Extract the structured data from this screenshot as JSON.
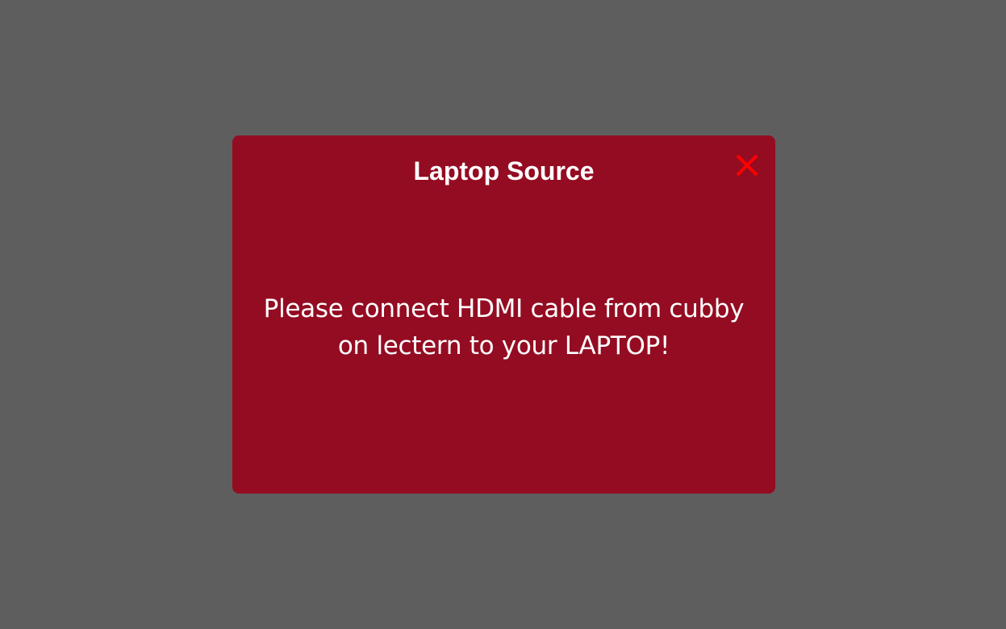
{
  "dialog": {
    "title": "Laptop Source",
    "message_lines": [
      "Please connect HDMI cable from cubby",
      "on lectern to your LAPTOP!"
    ],
    "close_icon": "close-icon"
  },
  "colors": {
    "backdrop": "#5e5e5e",
    "dialog_background": "#940c22",
    "text": "#ffffff",
    "close_icon": "#ff0000"
  }
}
